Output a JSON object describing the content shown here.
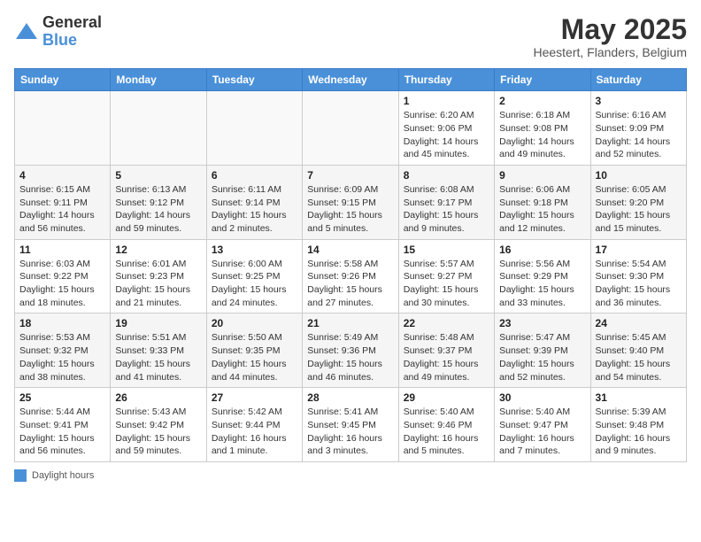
{
  "header": {
    "logo_general": "General",
    "logo_blue": "Blue",
    "month": "May 2025",
    "location": "Heestert, Flanders, Belgium"
  },
  "days_of_week": [
    "Sunday",
    "Monday",
    "Tuesday",
    "Wednesday",
    "Thursday",
    "Friday",
    "Saturday"
  ],
  "weeks": [
    [
      {
        "day": "",
        "info": ""
      },
      {
        "day": "",
        "info": ""
      },
      {
        "day": "",
        "info": ""
      },
      {
        "day": "",
        "info": ""
      },
      {
        "day": "1",
        "info": "Sunrise: 6:20 AM\nSunset: 9:06 PM\nDaylight: 14 hours and 45 minutes."
      },
      {
        "day": "2",
        "info": "Sunrise: 6:18 AM\nSunset: 9:08 PM\nDaylight: 14 hours and 49 minutes."
      },
      {
        "day": "3",
        "info": "Sunrise: 6:16 AM\nSunset: 9:09 PM\nDaylight: 14 hours and 52 minutes."
      }
    ],
    [
      {
        "day": "4",
        "info": "Sunrise: 6:15 AM\nSunset: 9:11 PM\nDaylight: 14 hours and 56 minutes."
      },
      {
        "day": "5",
        "info": "Sunrise: 6:13 AM\nSunset: 9:12 PM\nDaylight: 14 hours and 59 minutes."
      },
      {
        "day": "6",
        "info": "Sunrise: 6:11 AM\nSunset: 9:14 PM\nDaylight: 15 hours and 2 minutes."
      },
      {
        "day": "7",
        "info": "Sunrise: 6:09 AM\nSunset: 9:15 PM\nDaylight: 15 hours and 5 minutes."
      },
      {
        "day": "8",
        "info": "Sunrise: 6:08 AM\nSunset: 9:17 PM\nDaylight: 15 hours and 9 minutes."
      },
      {
        "day": "9",
        "info": "Sunrise: 6:06 AM\nSunset: 9:18 PM\nDaylight: 15 hours and 12 minutes."
      },
      {
        "day": "10",
        "info": "Sunrise: 6:05 AM\nSunset: 9:20 PM\nDaylight: 15 hours and 15 minutes."
      }
    ],
    [
      {
        "day": "11",
        "info": "Sunrise: 6:03 AM\nSunset: 9:22 PM\nDaylight: 15 hours and 18 minutes."
      },
      {
        "day": "12",
        "info": "Sunrise: 6:01 AM\nSunset: 9:23 PM\nDaylight: 15 hours and 21 minutes."
      },
      {
        "day": "13",
        "info": "Sunrise: 6:00 AM\nSunset: 9:25 PM\nDaylight: 15 hours and 24 minutes."
      },
      {
        "day": "14",
        "info": "Sunrise: 5:58 AM\nSunset: 9:26 PM\nDaylight: 15 hours and 27 minutes."
      },
      {
        "day": "15",
        "info": "Sunrise: 5:57 AM\nSunset: 9:27 PM\nDaylight: 15 hours and 30 minutes."
      },
      {
        "day": "16",
        "info": "Sunrise: 5:56 AM\nSunset: 9:29 PM\nDaylight: 15 hours and 33 minutes."
      },
      {
        "day": "17",
        "info": "Sunrise: 5:54 AM\nSunset: 9:30 PM\nDaylight: 15 hours and 36 minutes."
      }
    ],
    [
      {
        "day": "18",
        "info": "Sunrise: 5:53 AM\nSunset: 9:32 PM\nDaylight: 15 hours and 38 minutes."
      },
      {
        "day": "19",
        "info": "Sunrise: 5:51 AM\nSunset: 9:33 PM\nDaylight: 15 hours and 41 minutes."
      },
      {
        "day": "20",
        "info": "Sunrise: 5:50 AM\nSunset: 9:35 PM\nDaylight: 15 hours and 44 minutes."
      },
      {
        "day": "21",
        "info": "Sunrise: 5:49 AM\nSunset: 9:36 PM\nDaylight: 15 hours and 46 minutes."
      },
      {
        "day": "22",
        "info": "Sunrise: 5:48 AM\nSunset: 9:37 PM\nDaylight: 15 hours and 49 minutes."
      },
      {
        "day": "23",
        "info": "Sunrise: 5:47 AM\nSunset: 9:39 PM\nDaylight: 15 hours and 52 minutes."
      },
      {
        "day": "24",
        "info": "Sunrise: 5:45 AM\nSunset: 9:40 PM\nDaylight: 15 hours and 54 minutes."
      }
    ],
    [
      {
        "day": "25",
        "info": "Sunrise: 5:44 AM\nSunset: 9:41 PM\nDaylight: 15 hours and 56 minutes."
      },
      {
        "day": "26",
        "info": "Sunrise: 5:43 AM\nSunset: 9:42 PM\nDaylight: 15 hours and 59 minutes."
      },
      {
        "day": "27",
        "info": "Sunrise: 5:42 AM\nSunset: 9:44 PM\nDaylight: 16 hours and 1 minute."
      },
      {
        "day": "28",
        "info": "Sunrise: 5:41 AM\nSunset: 9:45 PM\nDaylight: 16 hours and 3 minutes."
      },
      {
        "day": "29",
        "info": "Sunrise: 5:40 AM\nSunset: 9:46 PM\nDaylight: 16 hours and 5 minutes."
      },
      {
        "day": "30",
        "info": "Sunrise: 5:40 AM\nSunset: 9:47 PM\nDaylight: 16 hours and 7 minutes."
      },
      {
        "day": "31",
        "info": "Sunrise: 5:39 AM\nSunset: 9:48 PM\nDaylight: 16 hours and 9 minutes."
      }
    ]
  ],
  "footer": {
    "label": "Daylight hours"
  }
}
